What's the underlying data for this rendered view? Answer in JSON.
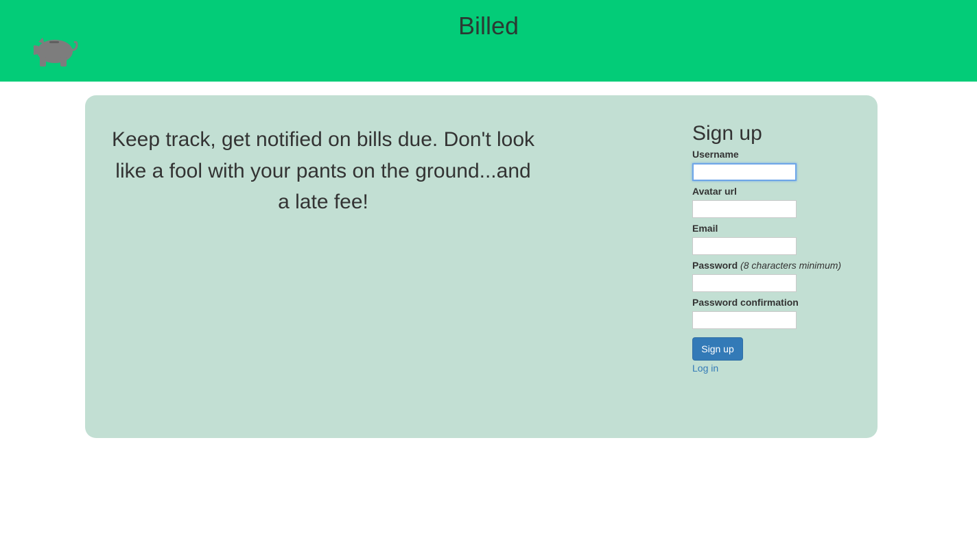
{
  "header": {
    "title": "Billed",
    "logo_icon": "piggy-bank-icon",
    "background_color": "#03cc78"
  },
  "main": {
    "tagline": "Keep track, get notified on bills due. Don't look like a fool with your pants on the ground...and a late fee!",
    "panel_color": "#c2dfd3"
  },
  "signup_form": {
    "heading": "Sign up",
    "fields": {
      "username": {
        "label": "Username",
        "value": ""
      },
      "avatar_url": {
        "label": "Avatar url",
        "value": ""
      },
      "email": {
        "label": "Email",
        "value": ""
      },
      "password": {
        "label": "Password",
        "hint": "(8 characters minimum)",
        "value": ""
      },
      "password_confirmation": {
        "label": "Password confirmation",
        "value": ""
      }
    },
    "submit_label": "Sign up",
    "login_link_label": "Log in",
    "button_color": "#337ab7"
  }
}
